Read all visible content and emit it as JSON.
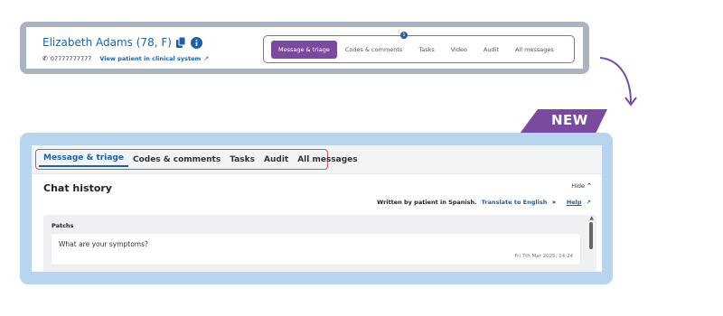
{
  "colors": {
    "old_frame": "#a9b4c0",
    "new_frame": "#b8d5f0",
    "accent_purple": "#7a4a9e",
    "link_blue": "#1f5fa8",
    "highlight_red": "#d9534f"
  },
  "old_header": {
    "patient_name": "Elizabeth Adams (78, F)",
    "phone": "07777777777",
    "view_patient_link": "View patient in clinical system",
    "notification_count": "1",
    "tabs": [
      {
        "label": "Message & triage",
        "active": true
      },
      {
        "label": "Codes & comments",
        "active": false
      },
      {
        "label": "Tasks",
        "active": false
      },
      {
        "label": "Video",
        "active": false
      },
      {
        "label": "Audit",
        "active": false
      },
      {
        "label": "All messages",
        "active": false
      }
    ],
    "icons": [
      "copy-icon",
      "info-icon",
      "phone-icon",
      "external-link-icon"
    ]
  },
  "badge": {
    "label": "NEW"
  },
  "new_panel": {
    "tabs": [
      {
        "label": "Message & triage",
        "active": true
      },
      {
        "label": "Codes & comments",
        "active": false
      },
      {
        "label": "Tasks",
        "active": false
      },
      {
        "label": "Audit",
        "active": false
      },
      {
        "label": "All messages",
        "active": false
      }
    ],
    "chat_title": "Chat history",
    "hide_label": "Hide",
    "written_by": "Written by patient in Spanish.",
    "translate_link": "Translate to English",
    "help_link": "Help",
    "chat": {
      "sender": "Patchs",
      "message": "What are your symptoms?",
      "timestamp": "Fri 7th Mar 2025, 14:24"
    }
  }
}
